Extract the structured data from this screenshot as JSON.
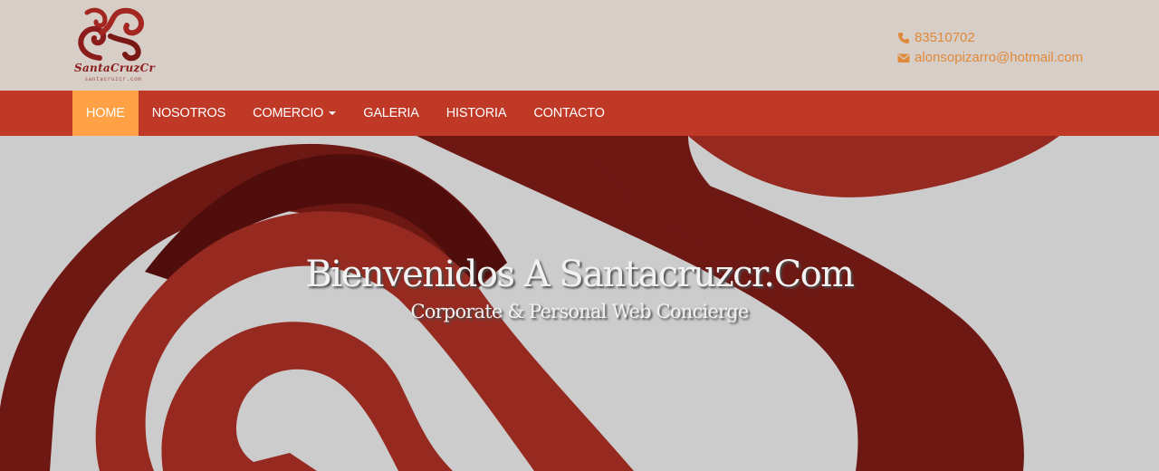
{
  "header": {
    "logo": {
      "name": "SantaCruzCr",
      "subtext": "santacruzcr.com"
    },
    "contact": {
      "phone": "83510702",
      "email": "alonsopizarro@hotmail.com",
      "phone_icon": "phone-icon",
      "email_icon": "envelope-icon"
    }
  },
  "nav": {
    "items": [
      {
        "label": "HOME",
        "active": true
      },
      {
        "label": "NOSOTROS"
      },
      {
        "label": "COMERCIO",
        "has_dropdown": true
      },
      {
        "label": "GALERIA"
      },
      {
        "label": "HISTORIA"
      },
      {
        "label": "CONTACTO"
      }
    ]
  },
  "hero": {
    "title": "Bienvenidos A Santacruzcr.Com",
    "subtitle": "Corporate & Personal Web Concierge"
  },
  "colors": {
    "topbar_bg": "#d7cec8",
    "navbar_bg": "#c03826",
    "nav_active_bg": "#ffa144",
    "contact_text": "#e0893a",
    "hero_bg": "#cccccc",
    "swirl_dark": "#6e1814",
    "swirl_mid": "#962a20"
  }
}
